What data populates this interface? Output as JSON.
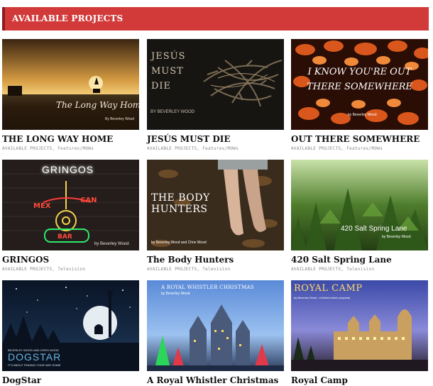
{
  "section_title": "AVAILABLE PROJECTS",
  "projects": [
    {
      "title": "THE LONG WAY HOME",
      "category": "AVAILABLE PROJECTS",
      "genre": "Features/MOWs",
      "poster_title": "The Long Way Home",
      "poster_byline": "By Beverley Wood"
    },
    {
      "title": "JESÚS MUST DIE",
      "category": "AVAILABLE PROJECTS",
      "genre": "Features/MOWs",
      "poster_line1": "JESÚS",
      "poster_line2": "MUST",
      "poster_line3": "DIE",
      "poster_byline": "BY BEVERLEY WOOD"
    },
    {
      "title": "OUT THERE SOMEWHERE",
      "category": "AVAILABLE PROJECTS",
      "genre": "Features/MOWs",
      "poster_line1": "I KNOW YOU'RE OUT",
      "poster_line2": "THERE SOMEWHERE",
      "poster_byline": "by Beverley Wood"
    },
    {
      "title": "GRINGOS",
      "category": "AVAILABLE PROJECTS",
      "genre": "Television",
      "poster_title": "GRINGOS",
      "poster_neon": "MEXICAN BAR",
      "poster_byline": "by Beverley Wood"
    },
    {
      "title": "The Body Hunters",
      "category": "AVAILABLE PROJECTS",
      "genre": "Television",
      "poster_line1": "THE BODY",
      "poster_line2": "HUNTERS",
      "poster_byline": "by Beverley Wood and Chris Wood"
    },
    {
      "title": "420 Salt Spring Lane",
      "category": "AVAILABLE PROJECTS",
      "genre": "Television",
      "poster_title": "420 Salt Spring Lane",
      "poster_byline": "by Beverley Wood"
    },
    {
      "title": "DogStar",
      "poster_title": "DOGSTAR",
      "poster_sub": "IT'S ABOUT FINDING YOUR WAY HOME",
      "poster_byline": "BEVERLEY WOOD AND CHRIS WOOD"
    },
    {
      "title": "A Royal Whistler Christmas",
      "poster_title": "A ROYAL WHISTLER CHRISTMAS",
      "poster_byline": "by Beverley Wood"
    },
    {
      "title": "Royal Camp",
      "poster_title": "ROYAL CAMP",
      "poster_byline": "by Beverley Wood - A limited series proposal"
    }
  ],
  "colors": {
    "header": "#d23a3a",
    "header_edge": "#8e1b1b",
    "title": "#111111",
    "meta": "#8a8a8a"
  }
}
